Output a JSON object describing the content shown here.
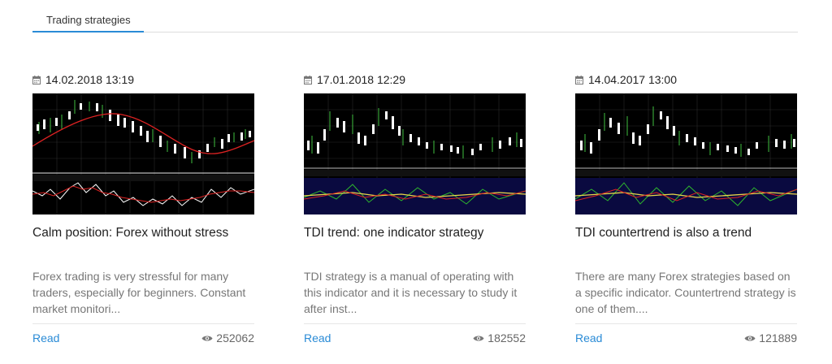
{
  "tabs": [
    {
      "label": "Trading strategies"
    }
  ],
  "colors": {
    "accent": "#2a8bd6"
  },
  "icons": {
    "date": "calendar-icon",
    "views": "eye-icon"
  },
  "articles": [
    {
      "date": "14.02.2018 13:19",
      "title": "Calm position: Forex without stress",
      "excerpt": "Forex trading is very stressful for many traders, especially for beginners. Constant market monitori...",
      "read_label": "Read",
      "views": "252062"
    },
    {
      "date": "17.01.2018 12:29",
      "title": "TDI trend: one indicator strategy",
      "excerpt": "TDI strategy is a manual of operating with this indicator and it is necessary to study it after inst...",
      "read_label": "Read",
      "views": "182552"
    },
    {
      "date": "14.04.2017 13:00",
      "title": "TDI countertrend is also a trend",
      "excerpt": "There are many Forex strategies based on a specific indicator. Countertrend strategy is one of them....",
      "read_label": "Read",
      "views": "121889"
    }
  ]
}
